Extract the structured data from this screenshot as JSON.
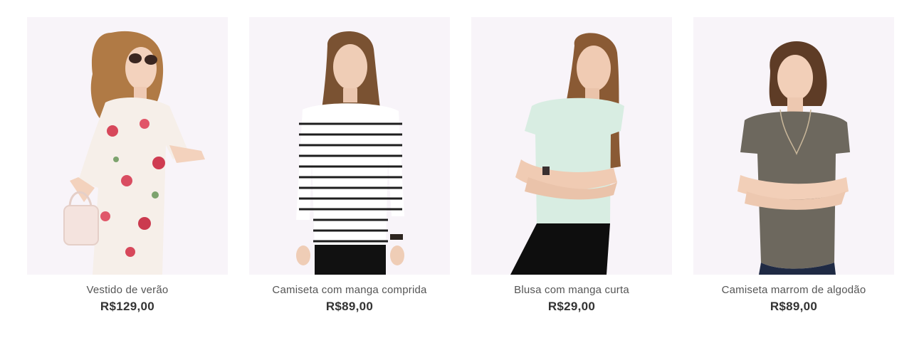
{
  "products": [
    {
      "name": "Vestido de verão",
      "price": "R$129,00",
      "image_alt": "model-floral-dress-photo"
    },
    {
      "name": "Camiseta com manga comprida",
      "price": "R$89,00",
      "image_alt": "model-striped-longsleeve-photo"
    },
    {
      "name": "Blusa com manga curta",
      "price": "R$29,00",
      "image_alt": "model-mint-blouse-photo"
    },
    {
      "name": "Camiseta marrom de algodão",
      "price": "R$89,00",
      "image_alt": "model-brown-tee-photo"
    }
  ],
  "colors": {
    "image_background": "#f8f4f9",
    "name_text": "#555555",
    "price_text": "#333333"
  }
}
